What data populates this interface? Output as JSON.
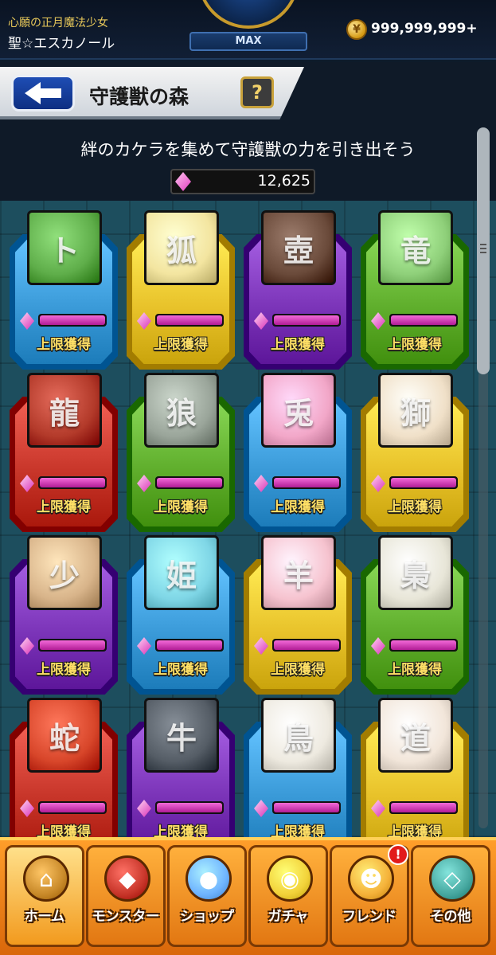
{
  "status": {
    "player_subtitle": "心願の正月魔法少女",
    "player_name": "聖☆エスカノール",
    "rank_label": "MAX",
    "coin_value": "999,999,999+"
  },
  "header": {
    "title": "守護獣の森",
    "help_label": "?"
  },
  "main": {
    "subtitle": "絆のカケラを集めて守護獣の力を引き出そう",
    "kakera_count": "12,625"
  },
  "colors": {
    "blue": "#3a9ad8",
    "yellow": "#e8c22a",
    "purple": "#7b34b8",
    "green": "#5fae2c",
    "red": "#c8362a"
  },
  "cards": [
    {
      "frame": "blue",
      "portrait_color": "#5fae4a",
      "initial": "ト",
      "label": "上限獲得",
      "level": 1.0
    },
    {
      "frame": "yellow",
      "portrait_color": "#f3e5a0",
      "initial": "狐",
      "label": "上限獲得",
      "level": 1.0
    },
    {
      "frame": "purple",
      "portrait_color": "#6a4a3a",
      "initial": "壺",
      "label": "上限獲得",
      "level": 1.0
    },
    {
      "frame": "green",
      "portrait_color": "#8fd07a",
      "initial": "竜",
      "label": "上限獲得",
      "level": 1.0
    },
    {
      "frame": "red",
      "portrait_color": "#b33a2a",
      "initial": "龍",
      "label": "上限獲得",
      "level": 1.0
    },
    {
      "frame": "green",
      "portrait_color": "#9aa59a",
      "initial": "狼",
      "label": "上限獲得",
      "level": 1.0
    },
    {
      "frame": "blue",
      "portrait_color": "#f2a7c8",
      "initial": "兎",
      "label": "上限獲得",
      "level": 1.0
    },
    {
      "frame": "yellow",
      "portrait_color": "#f0e0c8",
      "initial": "獅",
      "label": "上限獲得",
      "level": 1.0
    },
    {
      "frame": "purple",
      "portrait_color": "#d8b48a",
      "initial": "少",
      "label": "上限獲得",
      "level": 1.0
    },
    {
      "frame": "blue",
      "portrait_color": "#7fd6e6",
      "initial": "姫",
      "label": "上限獲得",
      "level": 1.0
    },
    {
      "frame": "yellow",
      "portrait_color": "#f6c3cf",
      "initial": "羊",
      "label": "上限獲得",
      "level": 1.0
    },
    {
      "frame": "green",
      "portrait_color": "#e8e6d8",
      "initial": "梟",
      "label": "上限獲得",
      "level": 1.0
    },
    {
      "frame": "red",
      "portrait_color": "#d8462a",
      "initial": "蛇",
      "label": "上限獲得",
      "level": 1.0
    },
    {
      "frame": "purple",
      "portrait_color": "#555d66",
      "initial": "牛",
      "label": "上限獲得",
      "level": 1.0
    },
    {
      "frame": "blue",
      "portrait_color": "#eeeae0",
      "initial": "鳥",
      "label": "上限獲得",
      "level": 1.0
    },
    {
      "frame": "yellow",
      "portrait_color": "#f2e6da",
      "initial": "道",
      "label": "上限獲得",
      "level": 1.0
    }
  ],
  "nav": [
    {
      "label": "ホーム",
      "icon": "home-gate-icon",
      "color": "#c98a2a",
      "glyph": "⌂"
    },
    {
      "label": "モンスター",
      "icon": "monster-icon",
      "color": "#c8362a",
      "glyph": "◆"
    },
    {
      "label": "ショップ",
      "icon": "orb-icon",
      "color": "#6fb4ff",
      "glyph": "●"
    },
    {
      "label": "ガチャ",
      "icon": "egg-icon",
      "color": "#f2d23a",
      "glyph": "◉"
    },
    {
      "label": "フレンド",
      "icon": "friends-icon",
      "color": "#f5b23a",
      "glyph": "☻",
      "badge": "!"
    },
    {
      "label": "その他",
      "icon": "more-icon",
      "color": "#47a8a0",
      "glyph": "◇"
    }
  ]
}
